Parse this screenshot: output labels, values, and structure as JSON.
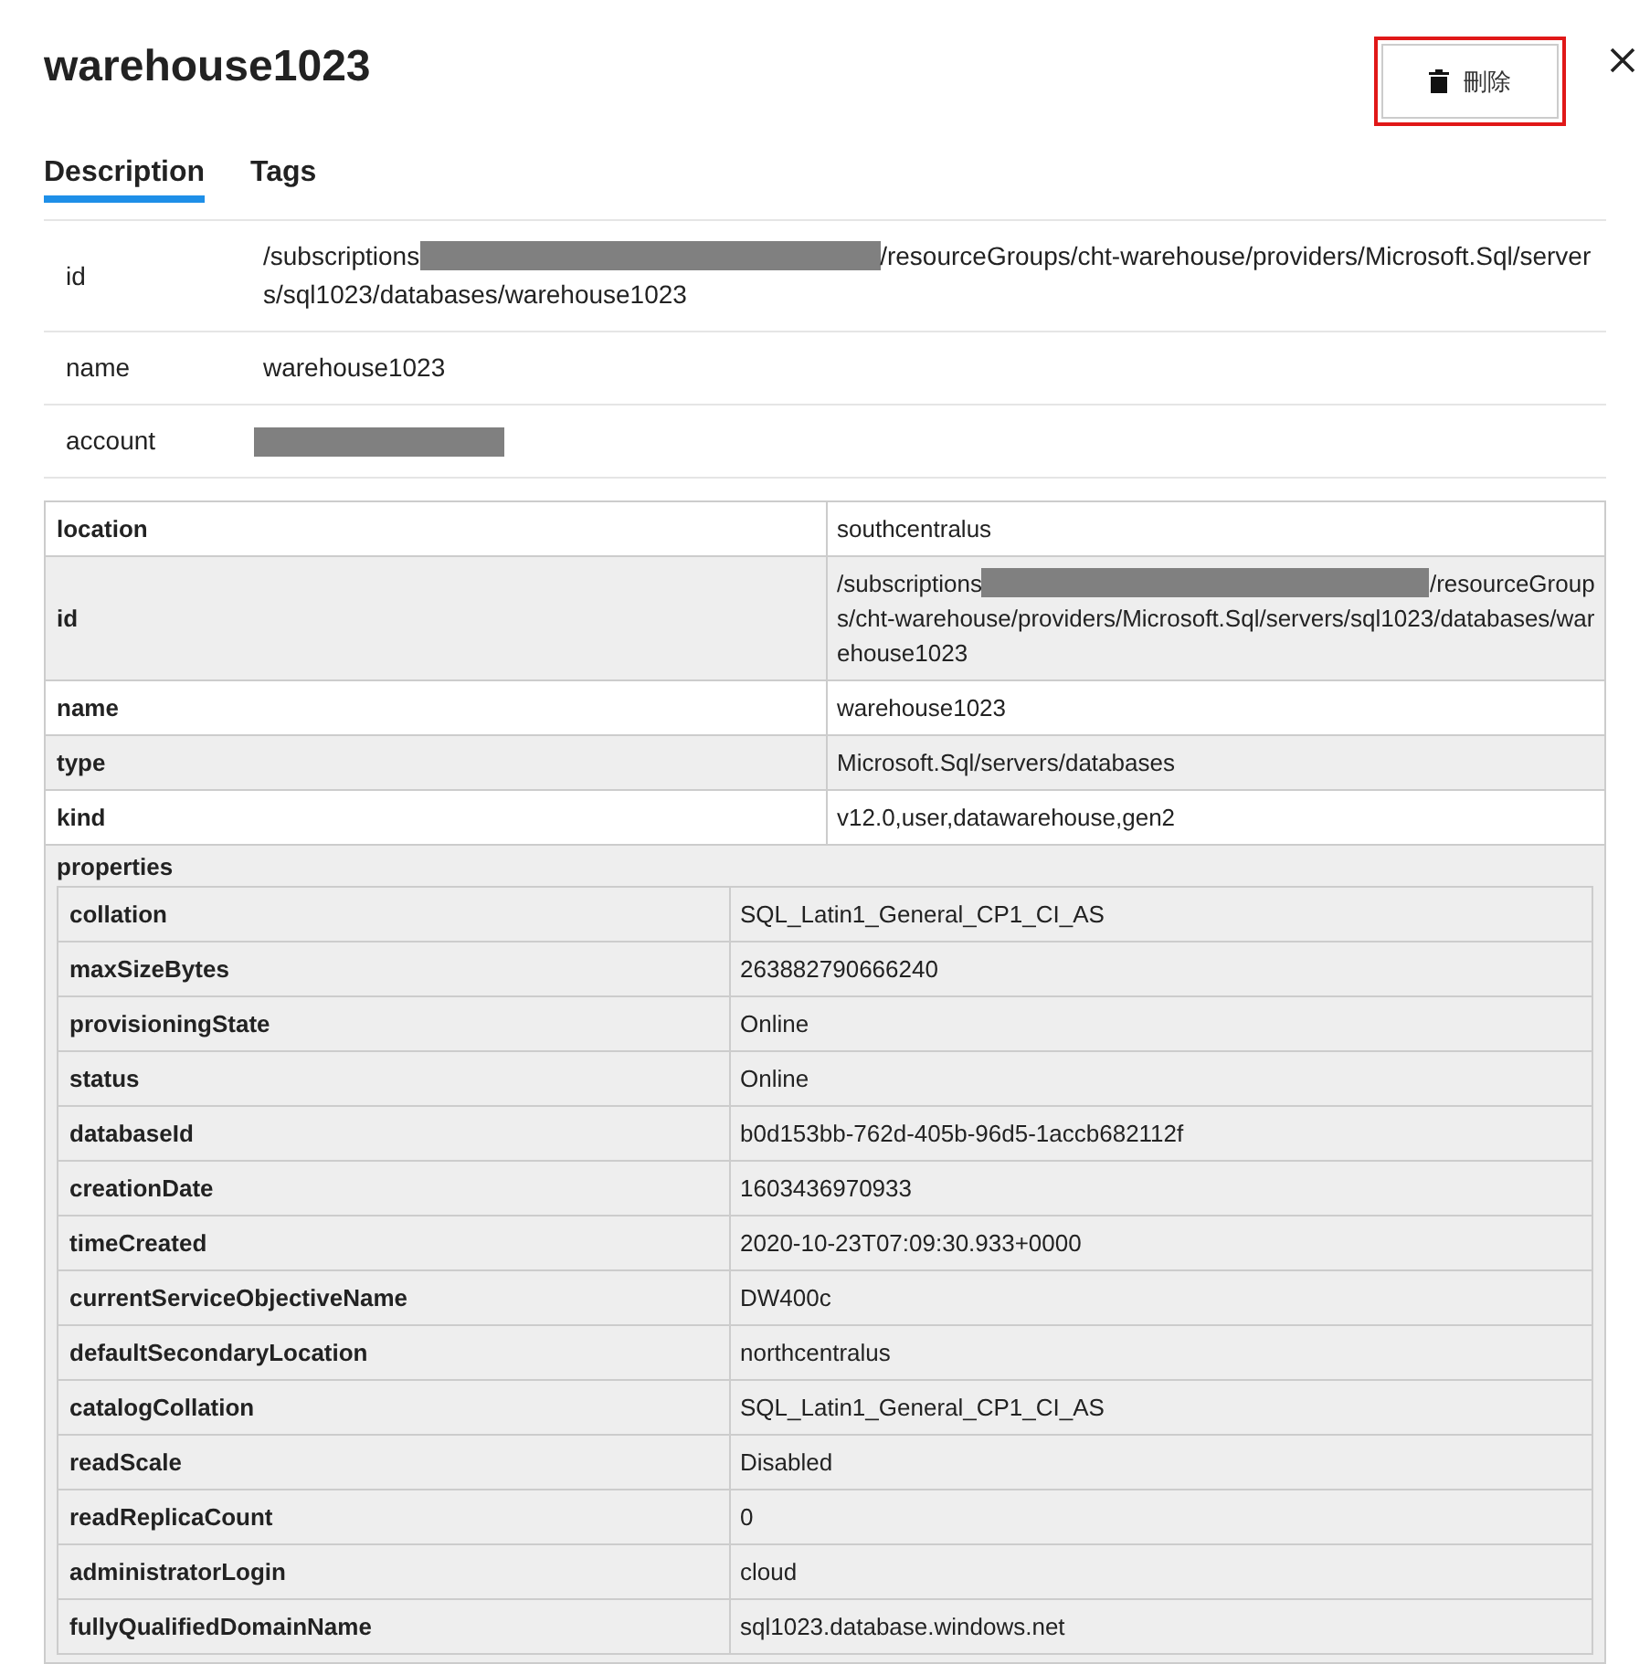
{
  "title": "warehouse1023",
  "delete_button": {
    "label": "刪除"
  },
  "tabs": [
    {
      "label": "Description",
      "selected": true
    },
    {
      "label": "Tags",
      "selected": false
    }
  ],
  "summary": [
    {
      "label": "id",
      "kind": "redacted",
      "prefix": "/subscriptions",
      "suffix": "/resourceGroups/cht-warehouse/providers/Microsoft.Sql/servers/sql1023/databases/warehouse1023"
    },
    {
      "label": "name",
      "kind": "text",
      "value": "warehouse1023"
    },
    {
      "label": "account",
      "kind": "redacted"
    }
  ],
  "details": {
    "rows": [
      {
        "key": "location",
        "kind": "text",
        "value": "southcentralus"
      },
      {
        "key": "id",
        "kind": "redacted",
        "prefix": "/subscriptions",
        "suffix": "/resourceGroups/cht-warehouse/providers/Microsoft.Sql/servers/sql1023/databases/warehouse1023"
      },
      {
        "key": "name",
        "kind": "text",
        "value": "warehouse1023"
      },
      {
        "key": "type",
        "kind": "text",
        "value": "Microsoft.Sql/servers/databases"
      },
      {
        "key": "kind",
        "kind": "text",
        "value": "v12.0,user,datawarehouse,gen2"
      }
    ],
    "properties": {
      "label": "properties",
      "rows": [
        {
          "key": "collation",
          "value": "SQL_Latin1_General_CP1_CI_AS"
        },
        {
          "key": "maxSizeBytes",
          "value": "263882790666240"
        },
        {
          "key": "provisioningState",
          "value": "Online"
        },
        {
          "key": "status",
          "value": "Online"
        },
        {
          "key": "databaseId",
          "value": "b0d153bb-762d-405b-96d5-1accb682112f"
        },
        {
          "key": "creationDate",
          "value": "1603436970933"
        },
        {
          "key": "timeCreated",
          "value": "2020-10-23T07:09:30.933+0000"
        },
        {
          "key": "currentServiceObjectiveName",
          "value": "DW400c"
        },
        {
          "key": "defaultSecondaryLocation",
          "value": "northcentralus"
        },
        {
          "key": "catalogCollation",
          "value": "SQL_Latin1_General_CP1_CI_AS"
        },
        {
          "key": "readScale",
          "value": "Disabled"
        },
        {
          "key": "readReplicaCount",
          "value": "0"
        },
        {
          "key": "administratorLogin",
          "value": "cloud"
        },
        {
          "key": "fullyQualifiedDomainName",
          "value": "sql1023.database.windows.net"
        }
      ]
    }
  }
}
